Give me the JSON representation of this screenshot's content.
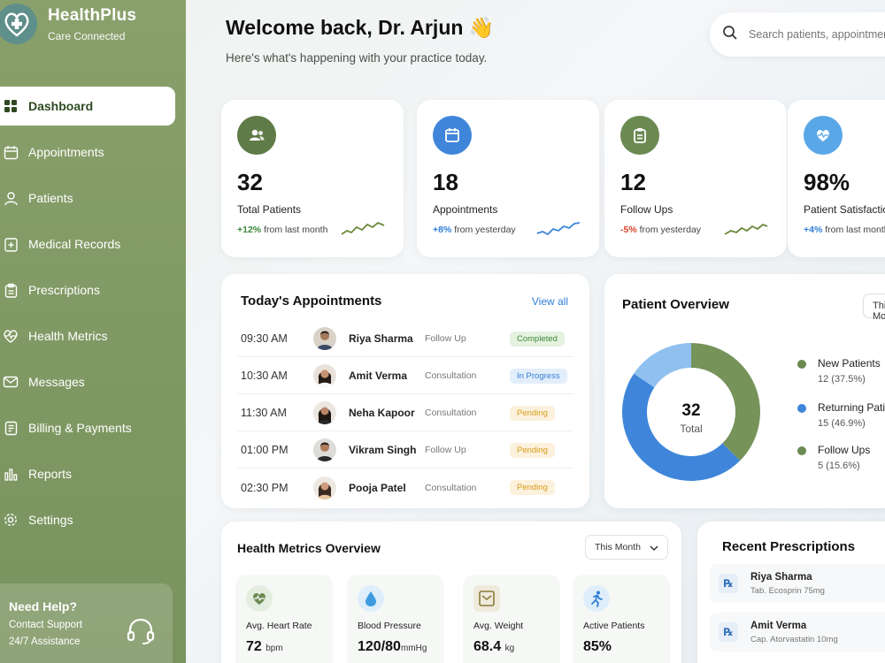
{
  "brand": {
    "name": "HealthPlus",
    "tagline": "Care Connected"
  },
  "nav": [
    {
      "label": "Dashboard",
      "icon": "grid-icon",
      "active": true
    },
    {
      "label": "Appointments",
      "icon": "calendar-icon"
    },
    {
      "label": "Patients",
      "icon": "user-icon"
    },
    {
      "label": "Medical Records",
      "icon": "folder-icon"
    },
    {
      "label": "Prescriptions",
      "icon": "clipboard-icon"
    },
    {
      "label": "Health Metrics",
      "icon": "heart-pulse-icon"
    },
    {
      "label": "Messages",
      "icon": "mail-icon"
    },
    {
      "label": "Billing & Payments",
      "icon": "receipt-icon"
    },
    {
      "label": "Reports",
      "icon": "bar-chart-icon"
    },
    {
      "label": "Settings",
      "icon": "gear-icon"
    }
  ],
  "help": {
    "title": "Need Help?",
    "line1": "Contact Support",
    "line2": "24/7 Assistance"
  },
  "header": {
    "welcome": "Welcome back, Dr. Arjun 👋",
    "subtitle": "Here's what's happening with your practice today.",
    "search_placeholder": "Search patients, appointments..."
  },
  "stats": [
    {
      "value": "32",
      "label": "Total Patients",
      "change": "+12%",
      "change_text": " from last month",
      "color": "#5f7b47"
    },
    {
      "value": "18",
      "label": "Appointments",
      "change": "+8%",
      "change_text": " from yesterday",
      "color": "#3f86da"
    },
    {
      "value": "12",
      "label": "Follow Ups",
      "change": "-5%",
      "change_text": " from yesterday",
      "color": "#6b8a52"
    },
    {
      "value": "98%",
      "label": "Patient Satisfaction",
      "change": "+4%",
      "change_text": " from last month",
      "color": "#5aa7e8"
    }
  ],
  "appointments": {
    "title": "Today's Appointments",
    "view_all": "View all",
    "rows": [
      {
        "time": "09:30 AM",
        "name": "Riya Sharma",
        "type": "Follow Up",
        "status": "Completed"
      },
      {
        "time": "10:30 AM",
        "name": "Amit Verma",
        "type": "Consultation",
        "status": "In Progress"
      },
      {
        "time": "11:30 AM",
        "name": "Neha Kapoor",
        "type": "Consultation",
        "status": "Pending"
      },
      {
        "time": "01:00 PM",
        "name": "Vikram Singh",
        "type": "Follow Up",
        "status": "Pending"
      },
      {
        "time": "02:30 PM",
        "name": "Pooja Patel",
        "type": "Consultation",
        "status": "Pending"
      }
    ]
  },
  "overview": {
    "title": "Patient Overview",
    "button": "This Month",
    "total_value": "32",
    "total_label": "Total",
    "segments": [
      {
        "name": "New Patients",
        "value": 12,
        "display": "12 (37.5%)",
        "color": "#76935a"
      },
      {
        "name": "Returning Patients",
        "value": 15,
        "display": "15 (46.9%)",
        "color": "#3f86da"
      },
      {
        "name": "Follow Ups",
        "value": 5,
        "display": "5 (15.6%)",
        "color": "#8fc0ef"
      }
    ]
  },
  "metrics": {
    "title": "Health Metrics Overview",
    "period": "This Month",
    "tiles": [
      {
        "label": "Avg. Heart Rate",
        "value": "72",
        "unit": "bpm"
      },
      {
        "label": "Blood Pressure",
        "value": "120/80",
        "unit": "mmHg"
      },
      {
        "label": "Avg. Weight",
        "value": "68.4",
        "unit": "kg"
      },
      {
        "label": "Active Patients",
        "value": "85%",
        "unit": ""
      }
    ]
  },
  "prescriptions": {
    "title": "Recent Prescriptions",
    "items": [
      {
        "name": "Riya Sharma",
        "drug": "Tab. Ecosprin 75mg"
      },
      {
        "name": "Amit Verma",
        "drug": "Cap. Atorvastatin 10mg"
      }
    ]
  }
}
